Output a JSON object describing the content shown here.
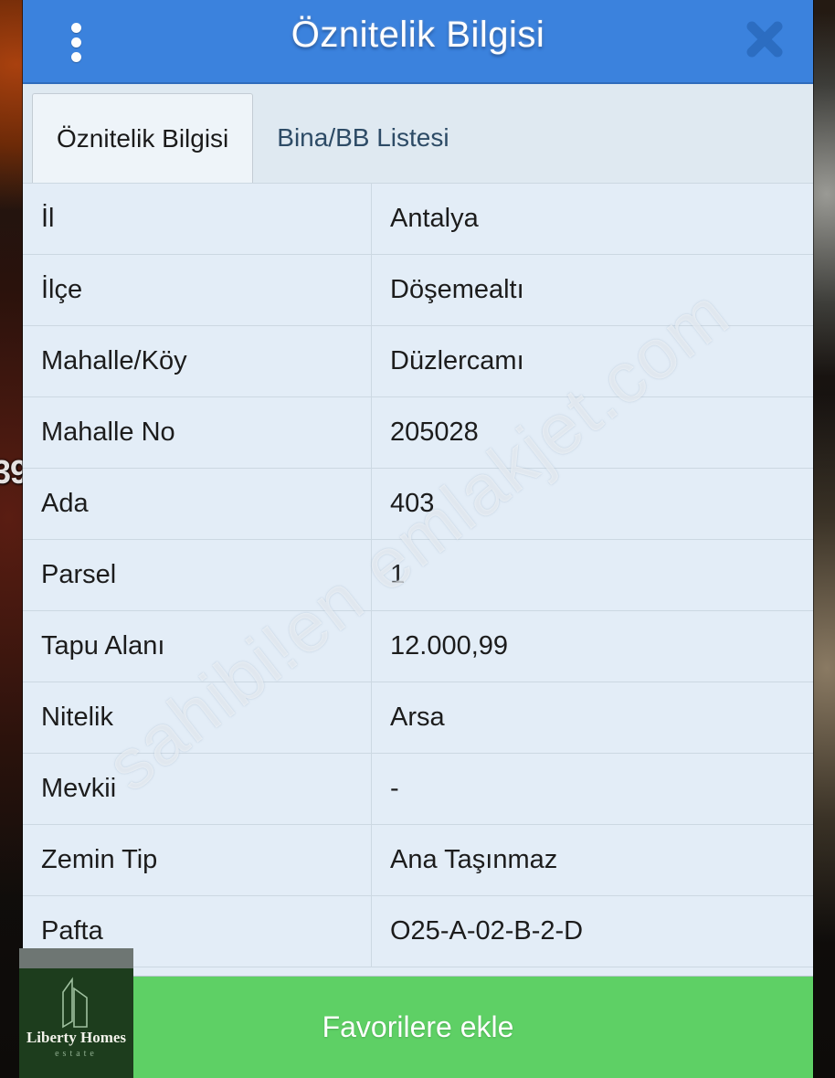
{
  "background": {
    "overlay_number": "39",
    "watermark_text": "sahibi!en emlakjet.com"
  },
  "titlebar": {
    "title": "Öznitelik Bilgisi",
    "menu_icon": "more-vertical-icon",
    "close_icon": "close-icon",
    "bg_color": "#3b82dd"
  },
  "tabs": [
    {
      "label": "Öznitelik Bilgisi",
      "active": true
    },
    {
      "label": "Bina/BB Listesi",
      "active": false
    }
  ],
  "table": {
    "rows": [
      {
        "label": "İl",
        "value": "Antalya"
      },
      {
        "label": "İlçe",
        "value": "Döşemealtı"
      },
      {
        "label": "Mahalle/Köy",
        "value": "Düzlercamı"
      },
      {
        "label": "Mahalle No",
        "value": "205028"
      },
      {
        "label": "Ada",
        "value": "403"
      },
      {
        "label": "Parsel",
        "value": "1"
      },
      {
        "label": "Tapu Alanı",
        "value": "12.000,99"
      },
      {
        "label": "Nitelik",
        "value": "Arsa"
      },
      {
        "label": "Mevkii",
        "value": "-"
      },
      {
        "label": "Zemin Tip",
        "value": "Ana Taşınmaz"
      },
      {
        "label": "Pafta",
        "value": "O25-A-02-B-2-D"
      }
    ]
  },
  "footer": {
    "favorite_label": "Favorilere ekle",
    "favorite_color": "#5ed065"
  },
  "logo": {
    "name": "Liberty Homes",
    "subtitle": "estate",
    "icon": "building-outline-icon"
  }
}
